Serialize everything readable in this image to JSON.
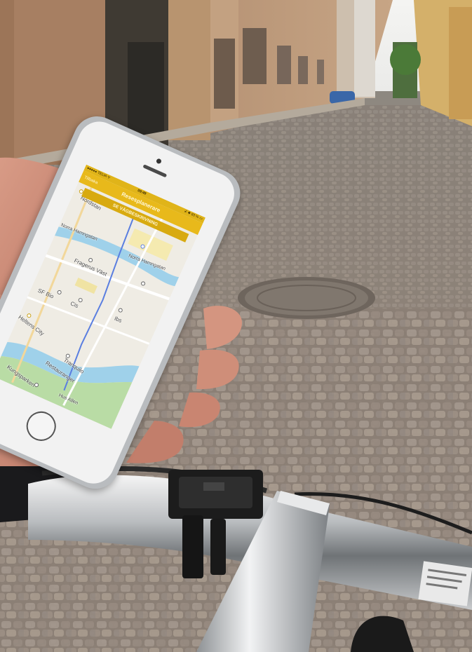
{
  "phone": {
    "status": {
      "carrier": "●●●●● TELIA ᯤ",
      "time": "09:49",
      "battery": "⊀ ✱ 83 % ▭"
    },
    "nav": {
      "back_label": "Tillbaka",
      "title": "Resesplanerare"
    },
    "route_banner": "SE VÄGBESKRIVNING",
    "map_labels": {
      "nordstan": "Nordstan",
      "norra_hamngatan_left": "Norra Hamngatan",
      "norra_hamngatan_right": "Norra Hamngatan",
      "fragerus": "Fragerus Väst",
      "sf_bio": "SF Bio",
      "cis": "Cis",
      "ibs": "Ibs",
      "city": "Heltens City",
      "tranquilo": "Tranquilo",
      "restaurang": "Restauranger",
      "kungsparken": "Kungsparken",
      "hus": "Hus Allen"
    }
  },
  "colors": {
    "app_yellow": "#e8b91b",
    "route_blue": "#5a7ee0",
    "water": "#9fd1ea",
    "park": "#b9dca5",
    "phone_frame": "#d9d9d9",
    "cobblestone": "#8e8279"
  },
  "icons": {
    "home_button": "home-button-circle",
    "location_pin": "location-pin-icon",
    "filter": "filter-icon"
  }
}
